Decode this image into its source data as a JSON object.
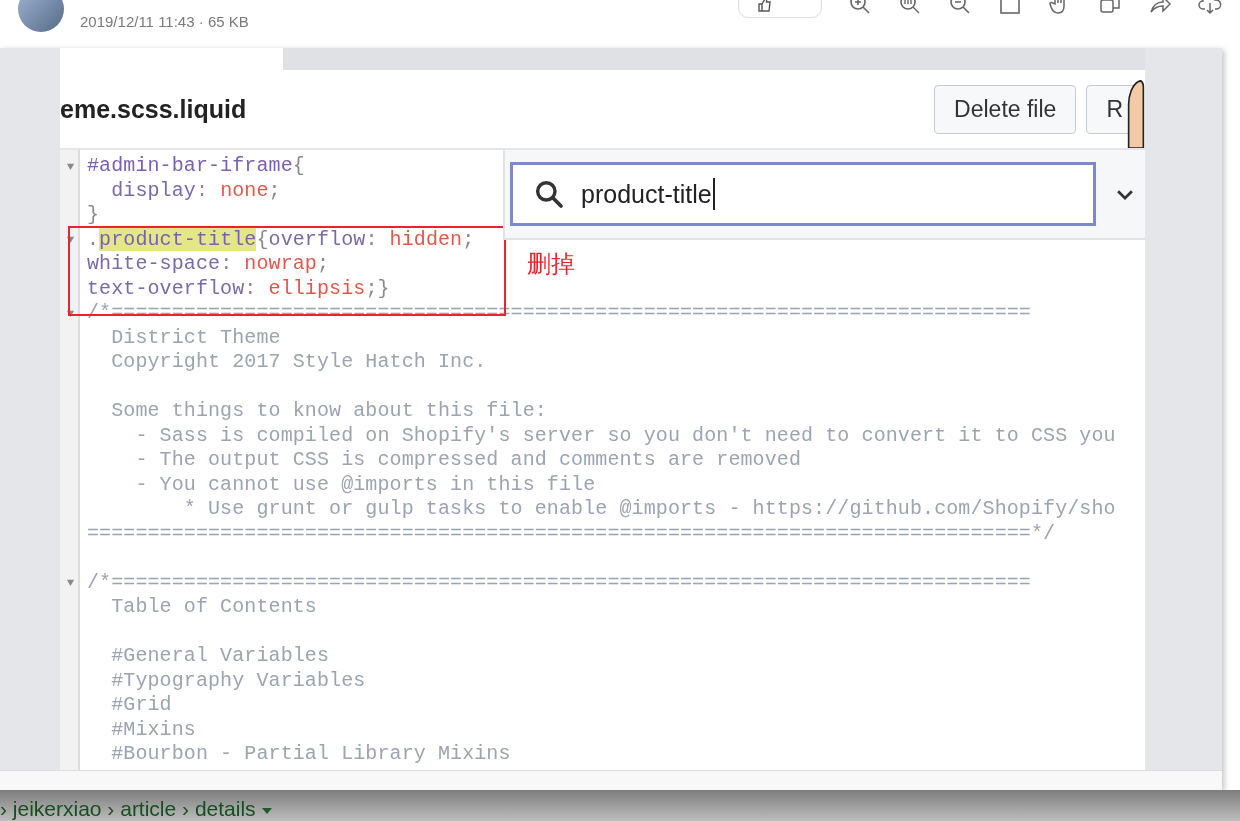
{
  "header": {
    "meta": "2019/12/11 11:43 · 65 KB"
  },
  "file": {
    "name": "eme.scss.liquid",
    "buttons": [
      "Delete file",
      "R"
    ]
  },
  "search": {
    "value": "product-title"
  },
  "code_lines": [
    {
      "fold": true,
      "tokens": [
        {
          "kind": "selector",
          "text": "#admin-bar-iframe"
        },
        {
          "kind": "punct",
          "text": "{"
        }
      ]
    },
    {
      "fold": false,
      "tokens": [
        {
          "kind": "property",
          "text": "  display"
        },
        {
          "kind": "punct",
          "text": ": "
        },
        {
          "kind": "value",
          "text": "none"
        },
        {
          "kind": "punct",
          "text": ";"
        }
      ]
    },
    {
      "fold": false,
      "tokens": [
        {
          "kind": "punct",
          "text": "}"
        }
      ]
    },
    {
      "fold": true,
      "tokens": [
        {
          "kind": "punct",
          "text": "."
        },
        {
          "kind": "match",
          "text": "product-title"
        },
        {
          "kind": "punct",
          "text": "{"
        },
        {
          "kind": "property",
          "text": "overflow"
        },
        {
          "kind": "punct",
          "text": ": "
        },
        {
          "kind": "value",
          "text": "hidden"
        },
        {
          "kind": "punct",
          "text": ";"
        }
      ]
    },
    {
      "fold": false,
      "tokens": [
        {
          "kind": "property",
          "text": "white-space"
        },
        {
          "kind": "punct",
          "text": ": "
        },
        {
          "kind": "value",
          "text": "nowrap"
        },
        {
          "kind": "punct",
          "text": ";"
        }
      ]
    },
    {
      "fold": false,
      "tokens": [
        {
          "kind": "property",
          "text": "text-overflow"
        },
        {
          "kind": "punct",
          "text": ": "
        },
        {
          "kind": "value",
          "text": "ellipsis"
        },
        {
          "kind": "punct",
          "text": ";}"
        }
      ]
    },
    {
      "fold": true,
      "tokens": [
        {
          "kind": "comment",
          "text": "/*============================================================================"
        }
      ]
    },
    {
      "fold": false,
      "tokens": [
        {
          "kind": "comment",
          "text": "  District Theme"
        }
      ]
    },
    {
      "fold": false,
      "tokens": [
        {
          "kind": "comment",
          "text": "  Copyright 2017 Style Hatch Inc."
        }
      ]
    },
    {
      "fold": false
    },
    {
      "fold": false,
      "tokens": [
        {
          "kind": "comment",
          "text": "  Some things to know about this file:"
        }
      ]
    },
    {
      "fold": false,
      "tokens": [
        {
          "kind": "comment",
          "text": "    - Sass is compiled on Shopify's server so you don't need to convert it to CSS you"
        }
      ]
    },
    {
      "fold": false,
      "tokens": [
        {
          "kind": "comment",
          "text": "    - The output CSS is compressed and comments are removed"
        }
      ]
    },
    {
      "fold": false,
      "tokens": [
        {
          "kind": "comment",
          "text": "    - You cannot use @imports in this file"
        }
      ]
    },
    {
      "fold": false,
      "tokens": [
        {
          "kind": "comment",
          "text": "        * Use grunt or gulp tasks to enable @imports - https://github.com/Shopify/sho"
        }
      ]
    },
    {
      "fold": false,
      "tokens": [
        {
          "kind": "comment",
          "text": "==============================================================================*/"
        }
      ]
    },
    {
      "fold": false
    },
    {
      "fold": true,
      "tokens": [
        {
          "kind": "comment",
          "text": "/*============================================================================"
        }
      ]
    },
    {
      "fold": false,
      "tokens": [
        {
          "kind": "comment",
          "text": "  Table of Contents"
        }
      ]
    },
    {
      "fold": false
    },
    {
      "fold": false,
      "tokens": [
        {
          "kind": "comment",
          "text": "  #General Variables"
        }
      ]
    },
    {
      "fold": false,
      "tokens": [
        {
          "kind": "comment",
          "text": "  #Typography Variables"
        }
      ]
    },
    {
      "fold": false,
      "tokens": [
        {
          "kind": "comment",
          "text": "  #Grid"
        }
      ]
    },
    {
      "fold": false,
      "tokens": [
        {
          "kind": "comment",
          "text": "  #Mixins"
        }
      ]
    },
    {
      "fold": false,
      "tokens": [
        {
          "kind": "comment",
          "text": "  #Bourbon - Partial Library Mixins"
        }
      ]
    }
  ],
  "annotation": {
    "note": "删掉"
  },
  "breadcrumb": {
    "path": "› jeikerxiao › article › details"
  }
}
